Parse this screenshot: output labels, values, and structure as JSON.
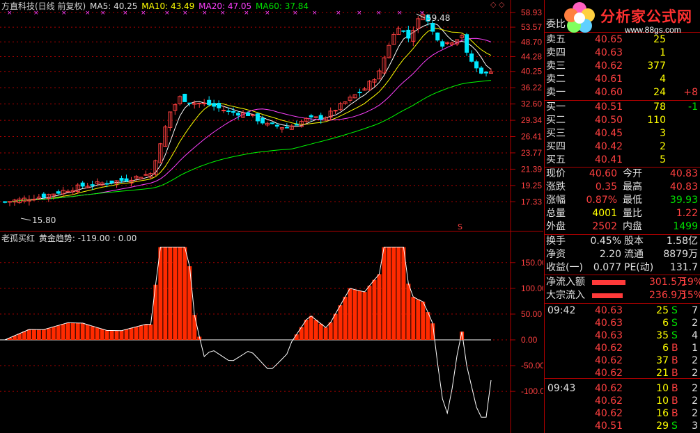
{
  "legend_main": {
    "stock": "方直科技(日线 前复权)",
    "ma5": "MA5: 40.25",
    "ma10": "MA10: 43.49",
    "ma20": "MA20: 47.05",
    "ma60": "MA60: 37.84"
  },
  "legend_indicator": {
    "name": "老孤买红",
    "sub": "黄金趋势: -119.00 : 0.00"
  },
  "price_axis": [
    "58.93",
    "53.57",
    "48.70",
    "44.28",
    "40.25",
    "36.22",
    "32.60",
    "29.34",
    "26.41",
    "23.77",
    "21.39",
    "19.25",
    "17.33"
  ],
  "indicator_axis": [
    "150.00",
    "100.00",
    "50.00",
    "0.00",
    "-50.00",
    "-100.00"
  ],
  "annotations": {
    "high": "59.48",
    "low": "15.80",
    "s_marker": "S"
  },
  "logo": {
    "title": "分析家公式网",
    "url": "www.88gs.com"
  },
  "colors": {
    "up": "#ff4040",
    "down": "#00e8ff",
    "ma5": "#ffffff",
    "ma10": "#ffff00",
    "ma20": "#ff40ff",
    "ma60": "#00ff00",
    "grid": "#b00000"
  },
  "orderbook": {
    "header_label": "委比",
    "sell": [
      {
        "label": "卖五",
        "price": "40.65",
        "vol": "25",
        "chg": ""
      },
      {
        "label": "卖四",
        "price": "40.63",
        "vol": "1",
        "chg": ""
      },
      {
        "label": "卖三",
        "price": "40.62",
        "vol": "377",
        "chg": ""
      },
      {
        "label": "卖二",
        "price": "40.61",
        "vol": "4",
        "chg": ""
      },
      {
        "label": "卖一",
        "price": "40.60",
        "vol": "24",
        "chg": "+8"
      }
    ],
    "buy": [
      {
        "label": "买一",
        "price": "40.51",
        "vol": "78",
        "chg": "-1"
      },
      {
        "label": "买二",
        "price": "40.50",
        "vol": "110",
        "chg": ""
      },
      {
        "label": "买三",
        "price": "40.45",
        "vol": "3",
        "chg": ""
      },
      {
        "label": "买四",
        "price": "40.42",
        "vol": "2",
        "chg": ""
      },
      {
        "label": "买五",
        "price": "40.41",
        "vol": "5",
        "chg": ""
      }
    ]
  },
  "quote": [
    {
      "l1": "现价",
      "v1": "40.60",
      "l2": "今开",
      "v2": "40.83",
      "c1": "red",
      "c2": "red"
    },
    {
      "l1": "涨跌",
      "v1": "0.35",
      "l2": "最高",
      "v2": "40.83",
      "c1": "red",
      "c2": "red"
    },
    {
      "l1": "涨幅",
      "v1": "0.87%",
      "l2": "最低",
      "v2": "39.93",
      "c1": "red",
      "c2": "green"
    },
    {
      "l1": "总量",
      "v1": "4001",
      "l2": "量比",
      "v2": "1.22",
      "c1": "yellow",
      "c2": "red"
    },
    {
      "l1": "外盘",
      "v1": "2502",
      "l2": "内盘",
      "v2": "1499",
      "c1": "red",
      "c2": "green"
    }
  ],
  "stats": [
    {
      "l1": "换手",
      "v1": "0.45%",
      "l2": "股本",
      "v2": "1.58亿"
    },
    {
      "l1": "净资",
      "v1": "2.20",
      "l2": "流通",
      "v2": "8879万"
    },
    {
      "l1": "收益(一)",
      "v1": "0.077",
      "l2": "PE(动)",
      "v2": "131.7"
    }
  ],
  "flows": [
    {
      "label": "净流入额",
      "amount": "301.5万",
      "pct": "19%",
      "bar": 0.6
    },
    {
      "label": "大宗流入",
      "amount": "236.9万",
      "pct": "15%",
      "bar": 0.55
    }
  ],
  "ticks": [
    {
      "time": "09:42",
      "price": "40.63",
      "vol": "25",
      "side": "S",
      "n": "7"
    },
    {
      "time": "",
      "price": "40.63",
      "vol": "6",
      "side": "S",
      "n": "2"
    },
    {
      "time": "",
      "price": "40.63",
      "vol": "35",
      "side": "S",
      "n": "4"
    },
    {
      "time": "",
      "price": "40.62",
      "vol": "6",
      "side": "B",
      "n": "1"
    },
    {
      "time": "",
      "price": "40.62",
      "vol": "37",
      "side": "B",
      "n": "2"
    },
    {
      "time": "",
      "price": "40.62",
      "vol": "21",
      "side": "B",
      "n": "2"
    },
    {
      "time": "09:43",
      "price": "40.62",
      "vol": "10",
      "side": "B",
      "n": "2"
    },
    {
      "time": "",
      "price": "40.62",
      "vol": "10",
      "side": "B",
      "n": "2"
    },
    {
      "time": "",
      "price": "40.62",
      "vol": "16",
      "side": "B",
      "n": "2"
    },
    {
      "time": "",
      "price": "40.51",
      "vol": "29",
      "side": "S",
      "n": "3"
    }
  ]
}
